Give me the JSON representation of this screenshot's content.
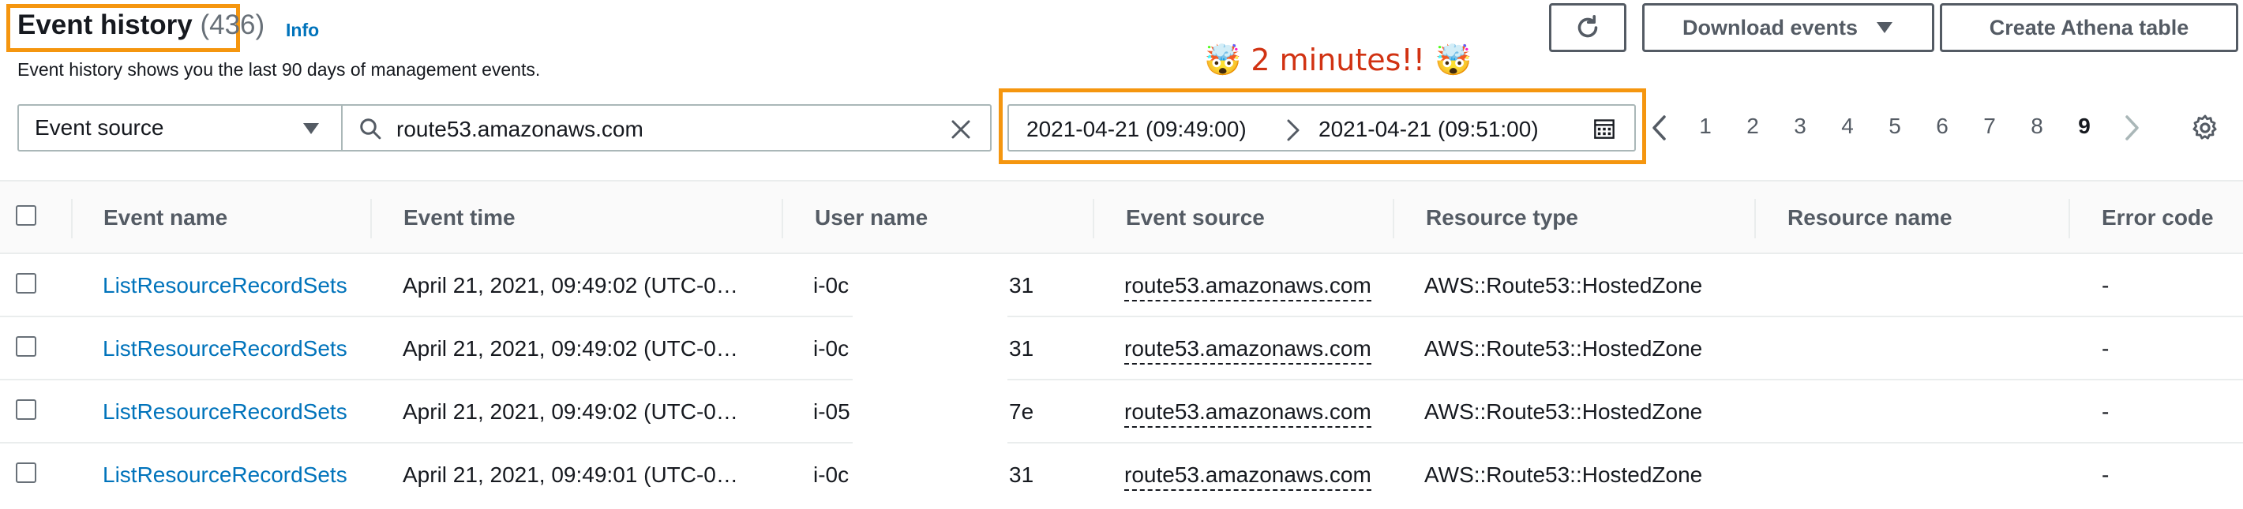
{
  "header": {
    "title": "Event history",
    "count": "(436)",
    "info": "Info",
    "subtitle": "Event history shows you the last 90 days of management events.",
    "annotation": "🤯 2 minutes!! 🤯"
  },
  "toolbar": {
    "refresh_icon": "refresh-icon",
    "download_label": "Download events",
    "athena_label": "Create Athena table"
  },
  "filter": {
    "attribute": "Event source",
    "search_value": "route53.amazonaws.com",
    "date_start": "2021-04-21 (09:49:00)",
    "date_end": "2021-04-21 (09:51:00)"
  },
  "pagination": {
    "pages": [
      "1",
      "2",
      "3",
      "4",
      "5",
      "6",
      "7",
      "8",
      "9"
    ],
    "current": "9"
  },
  "table": {
    "columns": [
      "Event name",
      "Event time",
      "User name",
      "Event source",
      "Resource type",
      "Resource name",
      "Error code"
    ],
    "rows": [
      {
        "event_name": "ListResourceRecordSets",
        "event_time": "April 21, 2021, 09:49:02 (UTC-0…",
        "user_prefix": "i-0c",
        "user_suffix": "31",
        "event_source": "route53.amazonaws.com",
        "resource_type": "AWS::Route53::HostedZone",
        "resource_name": "",
        "error_code": "-"
      },
      {
        "event_name": "ListResourceRecordSets",
        "event_time": "April 21, 2021, 09:49:02 (UTC-0…",
        "user_prefix": "i-0c",
        "user_suffix": "31",
        "event_source": "route53.amazonaws.com",
        "resource_type": "AWS::Route53::HostedZone",
        "resource_name": "",
        "error_code": "-"
      },
      {
        "event_name": "ListResourceRecordSets",
        "event_time": "April 21, 2021, 09:49:02 (UTC-0…",
        "user_prefix": "i-05",
        "user_suffix": "7e",
        "event_source": "route53.amazonaws.com",
        "resource_type": "AWS::Route53::HostedZone",
        "resource_name": "",
        "error_code": "-"
      },
      {
        "event_name": "ListResourceRecordSets",
        "event_time": "April 21, 2021, 09:49:01 (UTC-0…",
        "user_prefix": "i-0c",
        "user_suffix": "31",
        "event_source": "route53.amazonaws.com",
        "resource_type": "AWS::Route53::HostedZone",
        "resource_name": "",
        "error_code": "-"
      }
    ]
  },
  "colors": {
    "highlight": "#f5960f",
    "link": "#0073bb",
    "annotation": "#d13212"
  }
}
